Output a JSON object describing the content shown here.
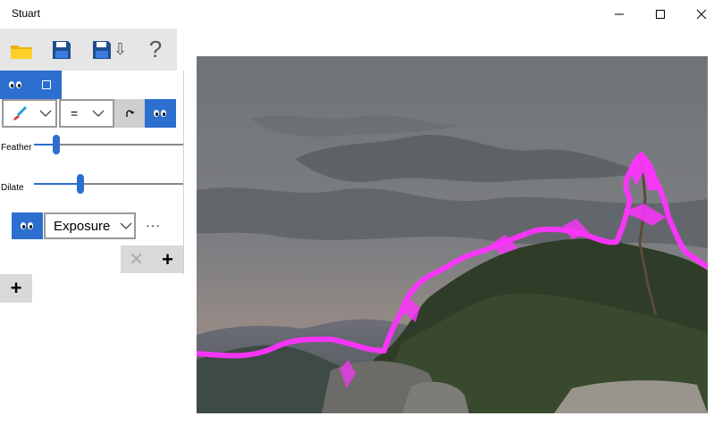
{
  "window": {
    "title": "Stuart",
    "controls": [
      "minimize",
      "maximize",
      "close"
    ]
  },
  "toolbar": {
    "items": [
      {
        "name": "open-folder",
        "icon": "folder-icon"
      },
      {
        "name": "save",
        "icon": "floppy-disk-icon"
      },
      {
        "name": "save-as",
        "icon": "floppy-disk-down-arrow-icon",
        "glyph": "⇩"
      },
      {
        "name": "help",
        "icon": "question-mark-icon",
        "glyph": "?"
      }
    ]
  },
  "mask_panel": {
    "tool_select": {
      "icon": "brush-icon"
    },
    "mode_select": {
      "value": "="
    },
    "feather_label": "Feather",
    "feather_value": 0.15,
    "dilate_label": "Dilate",
    "dilate_value": 0.3
  },
  "adjustment": {
    "selected": "Exposure",
    "more_label": "···"
  },
  "colors": {
    "accent": "#2d6fcf",
    "mask_overlay": "#ff33ff",
    "toolbar_bg": "#e6e6e6"
  }
}
